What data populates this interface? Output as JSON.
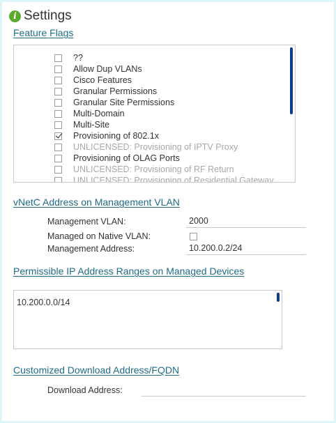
{
  "header": {
    "title": "Settings",
    "icon": "info-icon"
  },
  "feature_flags": {
    "heading": "Feature Flags",
    "items": [
      {
        "label": "??",
        "checked": false,
        "unlicensed": false
      },
      {
        "label": "Allow Dup VLANs",
        "checked": false,
        "unlicensed": false
      },
      {
        "label": "Cisco Features",
        "checked": false,
        "unlicensed": false
      },
      {
        "label": "Granular Permissions",
        "checked": false,
        "unlicensed": false
      },
      {
        "label": "Granular Site Permissions",
        "checked": false,
        "unlicensed": false
      },
      {
        "label": "Multi-Domain",
        "checked": false,
        "unlicensed": false
      },
      {
        "label": "Multi-Site",
        "checked": false,
        "unlicensed": false
      },
      {
        "label": "Provisioning of 802.1x",
        "checked": true,
        "unlicensed": false
      },
      {
        "label": "UNLICENSED: Provisioning of IPTV Proxy",
        "checked": false,
        "unlicensed": true
      },
      {
        "label": "Provisioning of OLAG Ports",
        "checked": false,
        "unlicensed": false
      },
      {
        "label": "UNLICENSED: Provisioning of RF Return",
        "checked": false,
        "unlicensed": true
      },
      {
        "label": "UNLICENSED: Provisioning of Residential Gateway",
        "checked": false,
        "unlicensed": true
      }
    ]
  },
  "vnetc": {
    "heading": "vNetC Address on Management VLAN",
    "management_vlan_label": "Management VLAN:",
    "management_vlan_value": "2000",
    "native_vlan_label": "Managed on Native VLAN:",
    "native_vlan_checked": false,
    "management_address_label": "Management Address:",
    "management_address_value": "10.200.0.2/24"
  },
  "ip_ranges": {
    "heading": "Permissible IP Address Ranges on Managed Devices",
    "value": "10.200.0.0/14"
  },
  "download": {
    "heading": "Customized Download Address/FQDN",
    "address_label": "Download Address:",
    "address_value": ""
  },
  "colors": {
    "accent": "#1e6b85",
    "scrollbar": "#0a3f8c",
    "info_icon": "#5aab2d",
    "frame": "#dff6f8"
  }
}
